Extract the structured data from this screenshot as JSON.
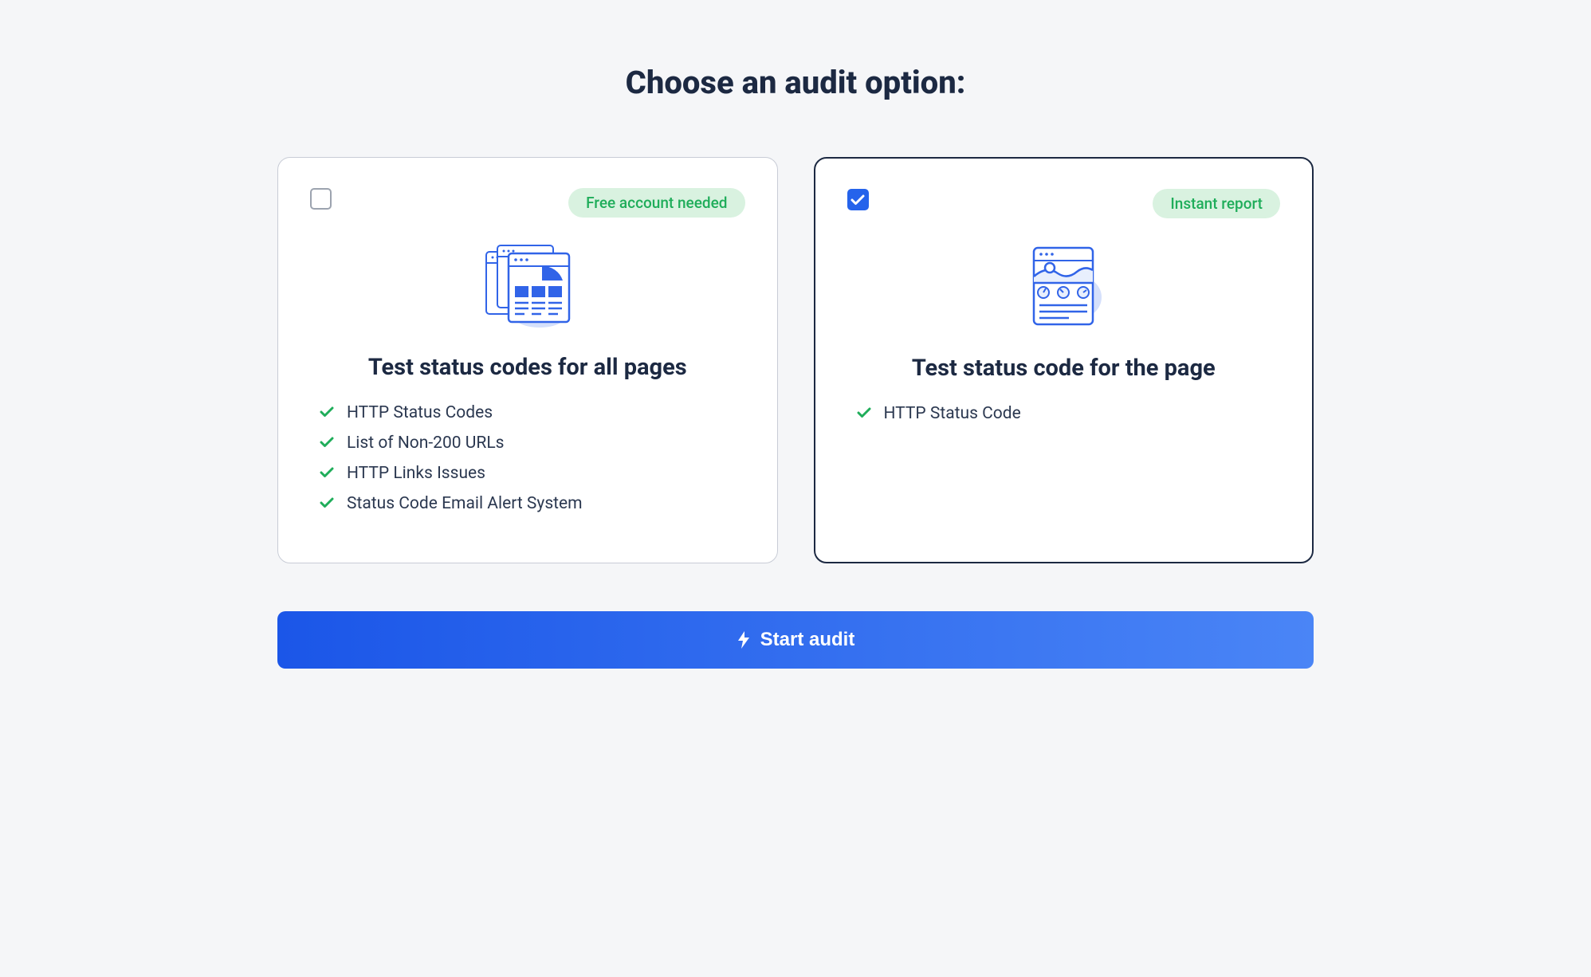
{
  "title": "Choose an audit option:",
  "cards": {
    "left": {
      "badge": "Free account needed",
      "title": "Test status codes for all pages",
      "features": [
        "HTTP Status Codes",
        "List of Non-200 URLs",
        "HTTP Links Issues",
        "Status Code Email Alert System"
      ]
    },
    "right": {
      "badge": "Instant report",
      "title": "Test status code for the page",
      "features": [
        "HTTP Status Code"
      ]
    }
  },
  "button": {
    "label": "Start audit"
  }
}
